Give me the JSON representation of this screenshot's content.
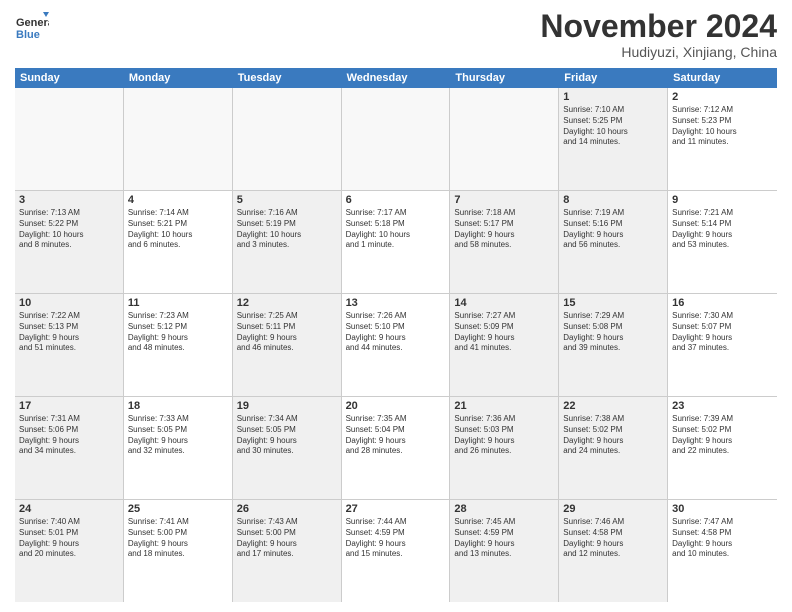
{
  "logo": {
    "general": "General",
    "blue": "Blue"
  },
  "title": "November 2024",
  "location": "Hudiyuzi, Xinjiang, China",
  "weekdays": [
    "Sunday",
    "Monday",
    "Tuesday",
    "Wednesday",
    "Thursday",
    "Friday",
    "Saturday"
  ],
  "rows": [
    [
      {
        "day": "",
        "info": "",
        "empty": true
      },
      {
        "day": "",
        "info": "",
        "empty": true
      },
      {
        "day": "",
        "info": "",
        "empty": true
      },
      {
        "day": "",
        "info": "",
        "empty": true
      },
      {
        "day": "",
        "info": "",
        "empty": true
      },
      {
        "day": "1",
        "info": "Sunrise: 7:10 AM\nSunset: 5:25 PM\nDaylight: 10 hours\nand 14 minutes.",
        "shaded": true
      },
      {
        "day": "2",
        "info": "Sunrise: 7:12 AM\nSunset: 5:23 PM\nDaylight: 10 hours\nand 11 minutes.",
        "shaded": false
      }
    ],
    [
      {
        "day": "3",
        "info": "Sunrise: 7:13 AM\nSunset: 5:22 PM\nDaylight: 10 hours\nand 8 minutes.",
        "shaded": true
      },
      {
        "day": "4",
        "info": "Sunrise: 7:14 AM\nSunset: 5:21 PM\nDaylight: 10 hours\nand 6 minutes.",
        "shaded": false
      },
      {
        "day": "5",
        "info": "Sunrise: 7:16 AM\nSunset: 5:19 PM\nDaylight: 10 hours\nand 3 minutes.",
        "shaded": true
      },
      {
        "day": "6",
        "info": "Sunrise: 7:17 AM\nSunset: 5:18 PM\nDaylight: 10 hours\nand 1 minute.",
        "shaded": false
      },
      {
        "day": "7",
        "info": "Sunrise: 7:18 AM\nSunset: 5:17 PM\nDaylight: 9 hours\nand 58 minutes.",
        "shaded": true
      },
      {
        "day": "8",
        "info": "Sunrise: 7:19 AM\nSunset: 5:16 PM\nDaylight: 9 hours\nand 56 minutes.",
        "shaded": true
      },
      {
        "day": "9",
        "info": "Sunrise: 7:21 AM\nSunset: 5:14 PM\nDaylight: 9 hours\nand 53 minutes.",
        "shaded": false
      }
    ],
    [
      {
        "day": "10",
        "info": "Sunrise: 7:22 AM\nSunset: 5:13 PM\nDaylight: 9 hours\nand 51 minutes.",
        "shaded": true
      },
      {
        "day": "11",
        "info": "Sunrise: 7:23 AM\nSunset: 5:12 PM\nDaylight: 9 hours\nand 48 minutes.",
        "shaded": false
      },
      {
        "day": "12",
        "info": "Sunrise: 7:25 AM\nSunset: 5:11 PM\nDaylight: 9 hours\nand 46 minutes.",
        "shaded": true
      },
      {
        "day": "13",
        "info": "Sunrise: 7:26 AM\nSunset: 5:10 PM\nDaylight: 9 hours\nand 44 minutes.",
        "shaded": false
      },
      {
        "day": "14",
        "info": "Sunrise: 7:27 AM\nSunset: 5:09 PM\nDaylight: 9 hours\nand 41 minutes.",
        "shaded": true
      },
      {
        "day": "15",
        "info": "Sunrise: 7:29 AM\nSunset: 5:08 PM\nDaylight: 9 hours\nand 39 minutes.",
        "shaded": true
      },
      {
        "day": "16",
        "info": "Sunrise: 7:30 AM\nSunset: 5:07 PM\nDaylight: 9 hours\nand 37 minutes.",
        "shaded": false
      }
    ],
    [
      {
        "day": "17",
        "info": "Sunrise: 7:31 AM\nSunset: 5:06 PM\nDaylight: 9 hours\nand 34 minutes.",
        "shaded": true
      },
      {
        "day": "18",
        "info": "Sunrise: 7:33 AM\nSunset: 5:05 PM\nDaylight: 9 hours\nand 32 minutes.",
        "shaded": false
      },
      {
        "day": "19",
        "info": "Sunrise: 7:34 AM\nSunset: 5:05 PM\nDaylight: 9 hours\nand 30 minutes.",
        "shaded": true
      },
      {
        "day": "20",
        "info": "Sunrise: 7:35 AM\nSunset: 5:04 PM\nDaylight: 9 hours\nand 28 minutes.",
        "shaded": false
      },
      {
        "day": "21",
        "info": "Sunrise: 7:36 AM\nSunset: 5:03 PM\nDaylight: 9 hours\nand 26 minutes.",
        "shaded": true
      },
      {
        "day": "22",
        "info": "Sunrise: 7:38 AM\nSunset: 5:02 PM\nDaylight: 9 hours\nand 24 minutes.",
        "shaded": true
      },
      {
        "day": "23",
        "info": "Sunrise: 7:39 AM\nSunset: 5:02 PM\nDaylight: 9 hours\nand 22 minutes.",
        "shaded": false
      }
    ],
    [
      {
        "day": "24",
        "info": "Sunrise: 7:40 AM\nSunset: 5:01 PM\nDaylight: 9 hours\nand 20 minutes.",
        "shaded": true
      },
      {
        "day": "25",
        "info": "Sunrise: 7:41 AM\nSunset: 5:00 PM\nDaylight: 9 hours\nand 18 minutes.",
        "shaded": false
      },
      {
        "day": "26",
        "info": "Sunrise: 7:43 AM\nSunset: 5:00 PM\nDaylight: 9 hours\nand 17 minutes.",
        "shaded": true
      },
      {
        "day": "27",
        "info": "Sunrise: 7:44 AM\nSunset: 4:59 PM\nDaylight: 9 hours\nand 15 minutes.",
        "shaded": false
      },
      {
        "day": "28",
        "info": "Sunrise: 7:45 AM\nSunset: 4:59 PM\nDaylight: 9 hours\nand 13 minutes.",
        "shaded": true
      },
      {
        "day": "29",
        "info": "Sunrise: 7:46 AM\nSunset: 4:58 PM\nDaylight: 9 hours\nand 12 minutes.",
        "shaded": true
      },
      {
        "day": "30",
        "info": "Sunrise: 7:47 AM\nSunset: 4:58 PM\nDaylight: 9 hours\nand 10 minutes.",
        "shaded": false
      }
    ]
  ]
}
